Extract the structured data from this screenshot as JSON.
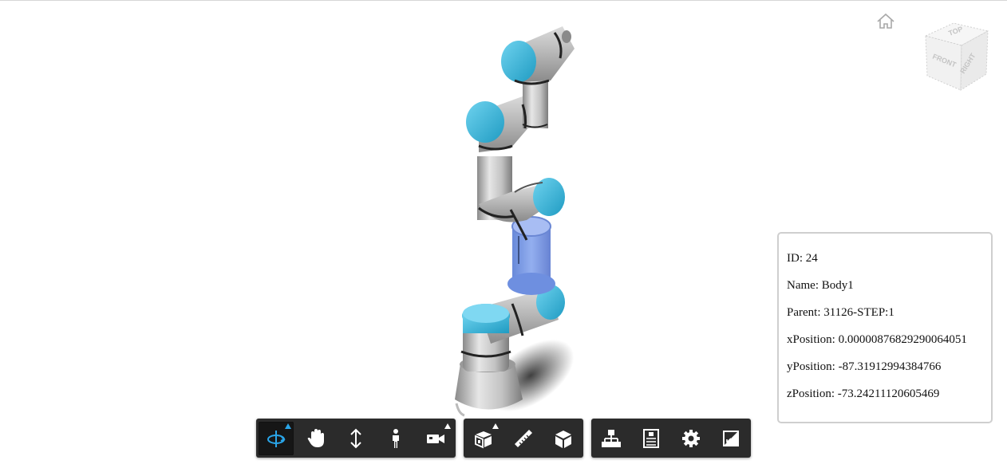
{
  "properties": {
    "id": "ID: 24",
    "name": "Name: Body1",
    "parent": "Parent: 31126-STEP:1",
    "x_position": "xPosition: 0.00000876829290064051",
    "y_position": "yPosition: -87.31912994384766",
    "z_position": "zPosition: -73.24211120605469"
  },
  "viewcube": {
    "top": "TOP",
    "front": "FRONT",
    "right": "RIGHT"
  },
  "colors": {
    "robot_cap": "#2fb3d8",
    "robot_body": "#b8b8b8",
    "selection_highlight": "#6e95e8",
    "toolbar": "#2b2b2b",
    "active_tool": "#2aa5e8"
  },
  "toolbar": {
    "groups": [
      [
        "orbit-icon",
        "pan-hand-icon",
        "zoom-arrows-icon",
        "walk-person-icon",
        "camera-icon"
      ],
      [
        "explode-cube-icon",
        "measure-ruler-icon",
        "section-box-icon"
      ],
      [
        "model-tree-icon",
        "properties-panel-icon",
        "settings-gear-icon",
        "fullscreen-icon"
      ]
    ],
    "active": "orbit-icon"
  }
}
